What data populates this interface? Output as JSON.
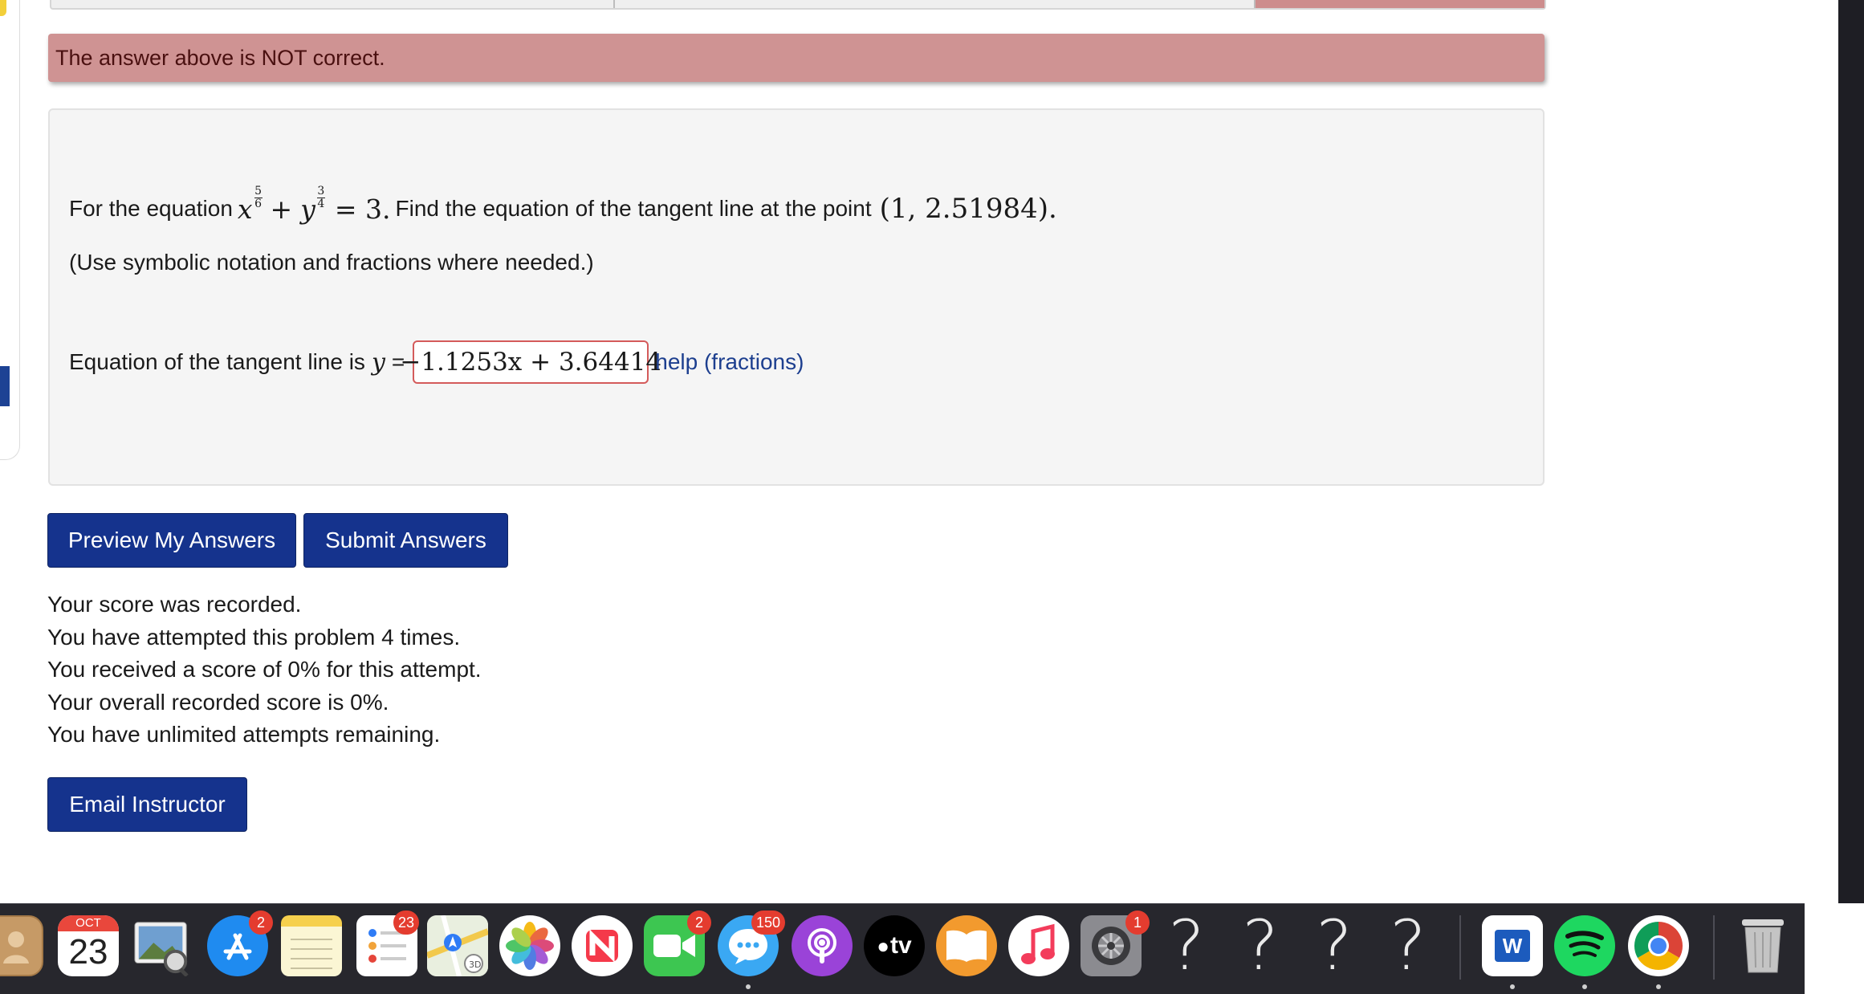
{
  "banner": {
    "message": "The answer above is NOT correct."
  },
  "problem": {
    "intro": "For the equation",
    "eq_x": "x",
    "exp_x_num": "5",
    "exp_x_den": "6",
    "eq_plus": "+",
    "eq_y": "y",
    "exp_y_num": "3",
    "exp_y_den": "4",
    "eq_rhs": "= 3.",
    "after": "Find the equation of the tangent line at the point",
    "point": "(1, 2.51984).",
    "note": "(Use symbolic notation and fractions where needed.)",
    "answer_label": "Equation of the tangent line is",
    "answer_var": "y",
    "answer_eq": "=",
    "answer_value": "−1.1253x + 3.64414",
    "help_link": "help (fractions)"
  },
  "buttons": {
    "preview": "Preview My Answers",
    "submit": "Submit Answers",
    "email": "Email Instructor"
  },
  "score": {
    "lines": [
      "Your score was recorded.",
      "You have attempted this problem 4 times.",
      "You received a score of 0% for this attempt.",
      "Your overall recorded score is 0%.",
      "You have unlimited attempts remaining."
    ]
  },
  "dock": {
    "calendar_month": "OCT",
    "calendar_day": "23",
    "badges": {
      "app_store": "2",
      "reminders": "23",
      "facetime": "2",
      "messages": "150",
      "system_settings": "1"
    },
    "tv_label": "tv",
    "word_label": "W",
    "placeholder_glyph": "?"
  }
}
